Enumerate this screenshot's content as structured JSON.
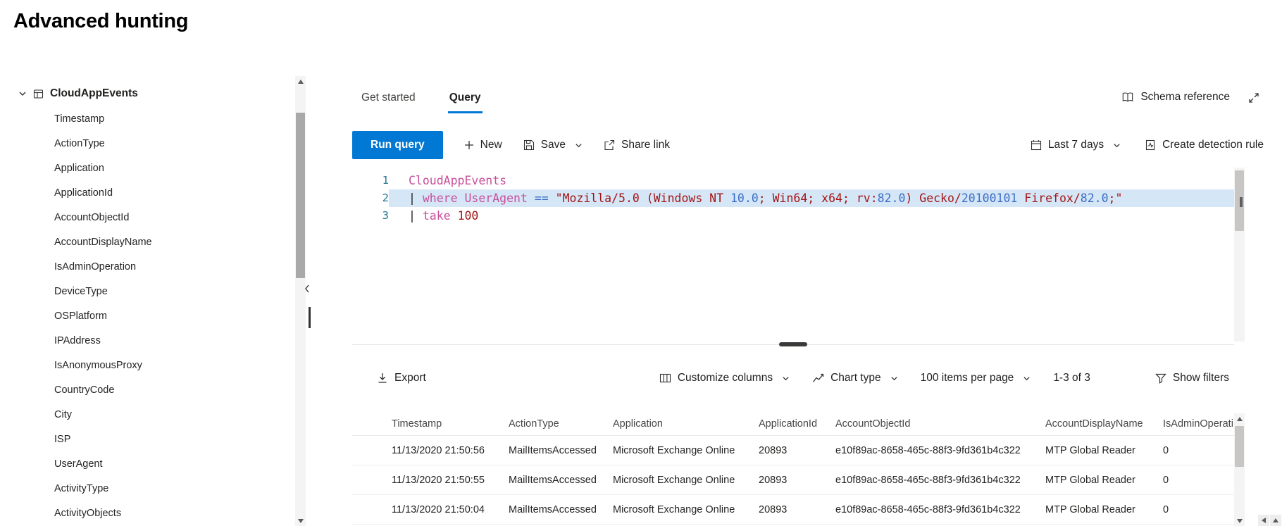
{
  "page": {
    "title": "Advanced hunting"
  },
  "sidebar": {
    "root_table": "CloudAppEvents",
    "fields": [
      "Timestamp",
      "ActionType",
      "Application",
      "ApplicationId",
      "AccountObjectId",
      "AccountDisplayName",
      "IsAdminOperation",
      "DeviceType",
      "OSPlatform",
      "IPAddress",
      "IsAnonymousProxy",
      "CountryCode",
      "City",
      "ISP",
      "UserAgent",
      "ActivityType",
      "ActivityObjects"
    ]
  },
  "tabs": [
    {
      "label": "Get started",
      "active": false
    },
    {
      "label": "Query",
      "active": true
    }
  ],
  "header": {
    "schema_reference_label": "Schema reference"
  },
  "command_bar": {
    "run_query_label": "Run query",
    "new_label": "New",
    "save_label": "Save",
    "share_link_label": "Share link",
    "time_range_label": "Last 7 days",
    "create_detection_rule_label": "Create detection rule"
  },
  "editor": {
    "lines": [
      {
        "number": 1,
        "highlight": false,
        "tokens": [
          {
            "t": "CloudAppEvents",
            "c": "table"
          }
        ]
      },
      {
        "number": 2,
        "highlight": true,
        "tokens": [
          {
            "t": "| ",
            "c": "plain"
          },
          {
            "t": "where",
            "c": "kw"
          },
          {
            "t": " ",
            "c": "plain"
          },
          {
            "t": "UserAgent",
            "c": "kw"
          },
          {
            "t": " ",
            "c": "plain"
          },
          {
            "t": "==",
            "c": "num"
          },
          {
            "t": " ",
            "c": "plain"
          },
          {
            "t": "\"Mozilla/5.0 (Windows NT ",
            "c": "str"
          },
          {
            "t": "10.0",
            "c": "num"
          },
          {
            "t": "; Win64; x64; rv:",
            "c": "str"
          },
          {
            "t": "82.0",
            "c": "num"
          },
          {
            "t": ") Gecko/",
            "c": "str"
          },
          {
            "t": "20100101",
            "c": "num"
          },
          {
            "t": " Firefox/",
            "c": "str"
          },
          {
            "t": "82.0",
            "c": "num"
          },
          {
            "t": ";\"",
            "c": "str"
          }
        ]
      },
      {
        "number": 3,
        "highlight": false,
        "tokens": [
          {
            "t": "| ",
            "c": "plain"
          },
          {
            "t": "take",
            "c": "kw"
          },
          {
            "t": " ",
            "c": "plain"
          },
          {
            "t": "100",
            "c": "str"
          }
        ]
      }
    ]
  },
  "results": {
    "export_label": "Export",
    "customize_columns_label": "Customize columns",
    "chart_type_label": "Chart type",
    "items_per_page_label": "100 items per page",
    "pagination_range": "1-3 of 3",
    "show_filters_label": "Show filters",
    "columns": [
      "Timestamp",
      "ActionType",
      "Application",
      "ApplicationId",
      "AccountObjectId",
      "AccountDisplayName",
      "IsAdminOperati"
    ],
    "rows": [
      [
        "11/13/2020 21:50:56",
        "MailItemsAccessed",
        "Microsoft Exchange Online",
        "20893",
        "e10f89ac-8658-465c-88f3-9fd361b4c322",
        "MTP Global Reader",
        "0"
      ],
      [
        "11/13/2020 21:50:55",
        "MailItemsAccessed",
        "Microsoft Exchange Online",
        "20893",
        "e10f89ac-8658-465c-88f3-9fd361b4c322",
        "MTP Global Reader",
        "0"
      ],
      [
        "11/13/2020 21:50:04",
        "MailItemsAccessed",
        "Microsoft Exchange Online",
        "20893",
        "e10f89ac-8658-465c-88f3-9fd361b4c322",
        "MTP Global Reader",
        "0"
      ]
    ]
  },
  "icons": {
    "chevron-down-icon": "v-chevron",
    "chevron-left-icon": "‹",
    "table-icon": "grid box",
    "book-icon": "open book",
    "expand-icon": "diagonal resize arrow",
    "plus-icon": "+",
    "save-icon": "floppy disk",
    "share-icon": "box with outgoing arrow",
    "calendar-icon": "calendar grid",
    "detection-rule-icon": "page with pulse line",
    "download-icon": "down arrow over bar",
    "columns-icon": "vertical columns box",
    "chart-icon": "line chart",
    "filter-icon": "funnel",
    "scroll-up-icon": "▲",
    "scroll-down-icon": "▼",
    "scroll-left-icon": "◀"
  },
  "colors": {
    "accent": "#0078d4",
    "code_keyword": "#c94f9b",
    "code_string": "#a31515",
    "code_number": "#3b6ec5",
    "line_number": "#237893",
    "line_highlight": "#d5e6f7"
  }
}
